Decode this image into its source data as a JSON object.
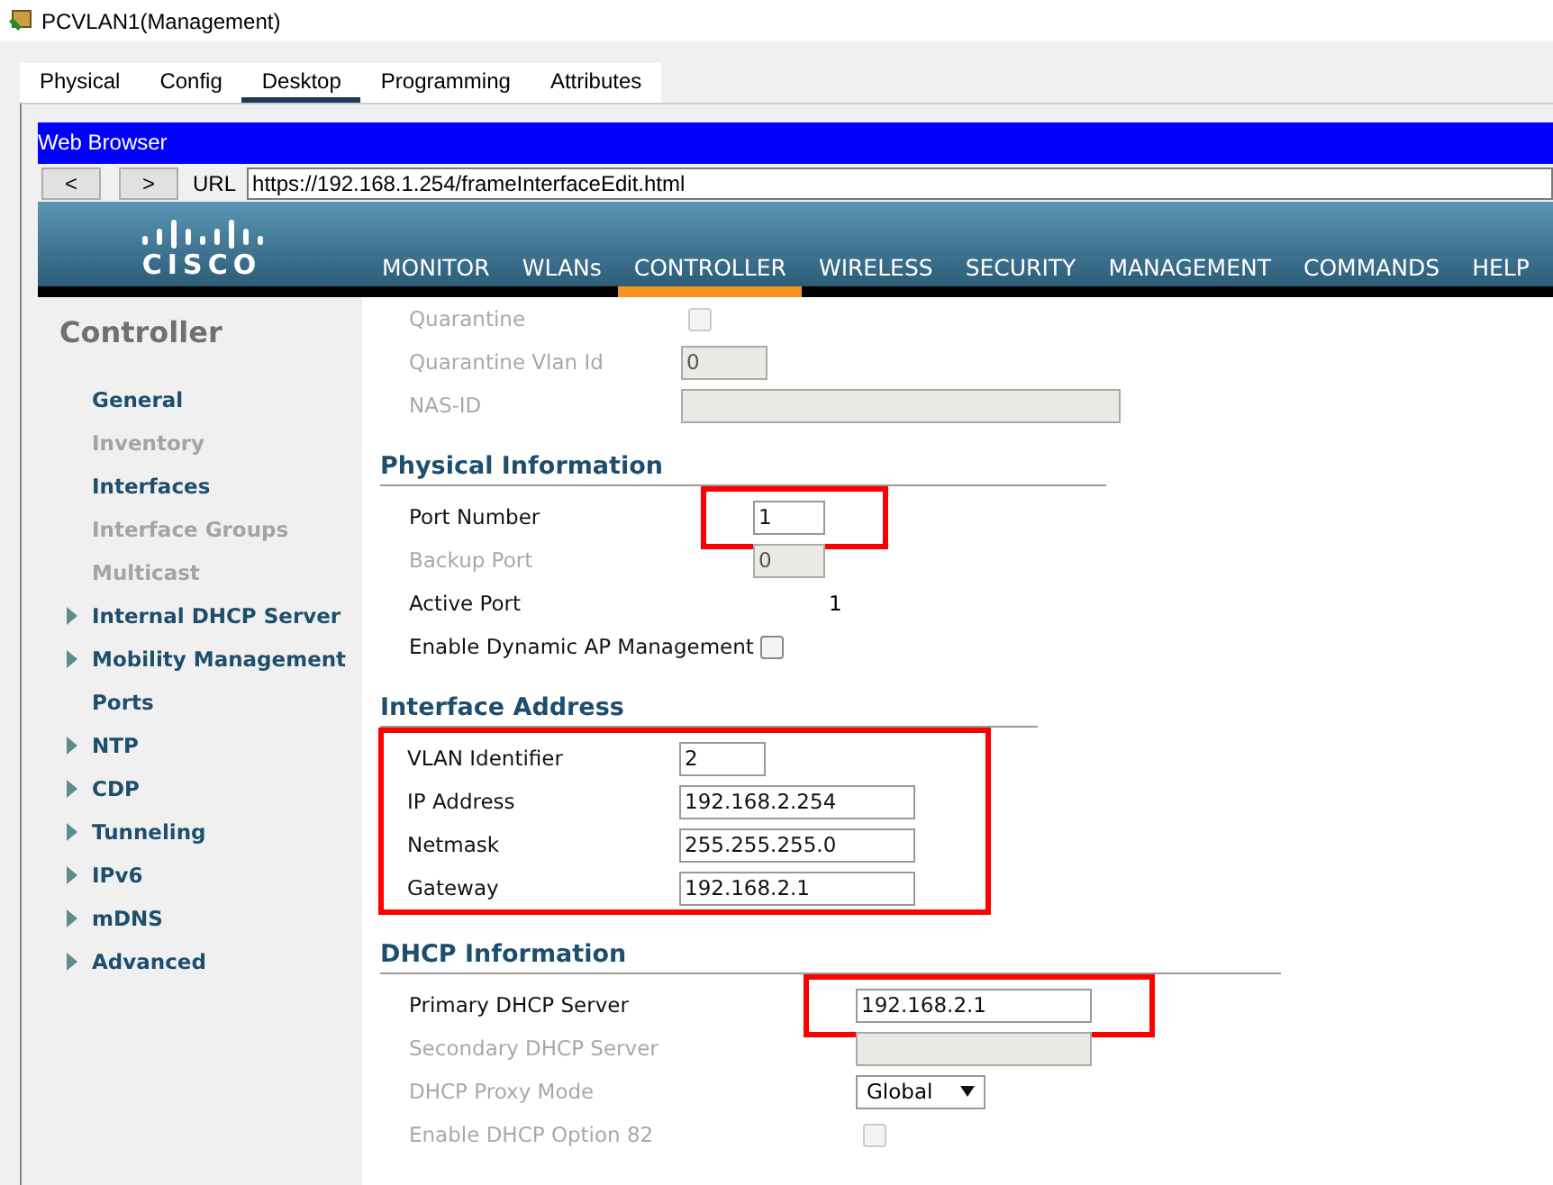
{
  "window": {
    "title": "PCVLAN1(Management)"
  },
  "tabs": [
    {
      "label": "Physical",
      "selected": false
    },
    {
      "label": "Config",
      "selected": false
    },
    {
      "label": "Desktop",
      "selected": true
    },
    {
      "label": "Programming",
      "selected": false
    },
    {
      "label": "Attributes",
      "selected": false
    }
  ],
  "browser": {
    "title": "Web Browser",
    "back": "<",
    "forward": ">",
    "url_label": "URL",
    "url": "https://192.168.1.254/frameInterfaceEdit.html"
  },
  "nav": [
    {
      "label": "MONITOR",
      "selected": false
    },
    {
      "label": "WLANs",
      "selected": false
    },
    {
      "label": "CONTROLLER",
      "selected": true
    },
    {
      "label": "WIRELESS",
      "selected": false
    },
    {
      "label": "SECURITY",
      "selected": false
    },
    {
      "label": "MANAGEMENT",
      "selected": false
    },
    {
      "label": "COMMANDS",
      "selected": false
    },
    {
      "label": "HELP",
      "selected": false
    }
  ],
  "logo": {
    "text": "CISCO"
  },
  "sidebar": {
    "title": "Controller",
    "items": [
      {
        "label": "General",
        "disabled": false,
        "expandable": false
      },
      {
        "label": "Inventory",
        "disabled": true,
        "expandable": false
      },
      {
        "label": "Interfaces",
        "disabled": false,
        "expandable": false
      },
      {
        "label": "Interface Groups",
        "disabled": true,
        "expandable": false
      },
      {
        "label": "Multicast",
        "disabled": true,
        "expandable": false
      },
      {
        "label": "Internal DHCP Server",
        "disabled": false,
        "expandable": true
      },
      {
        "label": "Mobility Management",
        "disabled": false,
        "expandable": true
      },
      {
        "label": "Ports",
        "disabled": false,
        "expandable": false
      },
      {
        "label": "NTP",
        "disabled": false,
        "expandable": true
      },
      {
        "label": "CDP",
        "disabled": false,
        "expandable": true
      },
      {
        "label": "Tunneling",
        "disabled": false,
        "expandable": true
      },
      {
        "label": "IPv6",
        "disabled": false,
        "expandable": true
      },
      {
        "label": "mDNS",
        "disabled": false,
        "expandable": true
      },
      {
        "label": "Advanced",
        "disabled": false,
        "expandable": true
      }
    ]
  },
  "sections": [
    {
      "highlighted": false,
      "rows": [
        {
          "kind": "checkbox",
          "label": "Quarantine",
          "disabled": true,
          "checked": false
        },
        {
          "kind": "input",
          "label": "Quarantine Vlan Id",
          "value": "0",
          "disabled": true,
          "highlighted": false
        },
        {
          "kind": "input",
          "label": "NAS-ID",
          "disabled": true,
          "highlighted": false
        }
      ]
    },
    {
      "heading": "Physical Information",
      "highlighted": false,
      "rows": [
        {
          "kind": "input",
          "label": "Port Number",
          "value": "1",
          "disabled": false,
          "highlighted": true
        },
        {
          "kind": "input",
          "label": "Backup Port",
          "value": "0",
          "disabled": true,
          "highlighted": false
        },
        {
          "kind": "text",
          "label": "Active Port",
          "value": "1",
          "disabled": false
        },
        {
          "kind": "checkbox",
          "label": "Enable Dynamic AP Management",
          "disabled": false,
          "checked": false
        }
      ]
    },
    {
      "heading": "Interface Address",
      "highlighted": true,
      "rows": [
        {
          "kind": "input",
          "label": "VLAN Identifier",
          "value": "2",
          "disabled": false,
          "highlighted": false
        },
        {
          "kind": "input",
          "label": "IP Address",
          "value": "192.168.2.254",
          "disabled": false,
          "highlighted": false
        },
        {
          "kind": "input",
          "label": "Netmask",
          "value": "255.255.255.0",
          "disabled": false,
          "highlighted": false
        },
        {
          "kind": "input",
          "label": "Gateway",
          "value": "192.168.2.1",
          "disabled": false,
          "highlighted": false
        }
      ]
    },
    {
      "heading": "DHCP Information",
      "highlighted": false,
      "rows": [
        {
          "kind": "input",
          "label": "Primary DHCP Server",
          "value": "192.168.2.1",
          "disabled": false,
          "highlighted": true
        },
        {
          "kind": "input",
          "label": "Secondary DHCP Server",
          "disabled": true,
          "highlighted": false
        },
        {
          "kind": "select",
          "label": "DHCP Proxy Mode",
          "value": "Global",
          "disabled": true
        },
        {
          "kind": "checkbox",
          "label": "Enable DHCP Option 82",
          "disabled": true,
          "checked": false
        }
      ]
    }
  ]
}
